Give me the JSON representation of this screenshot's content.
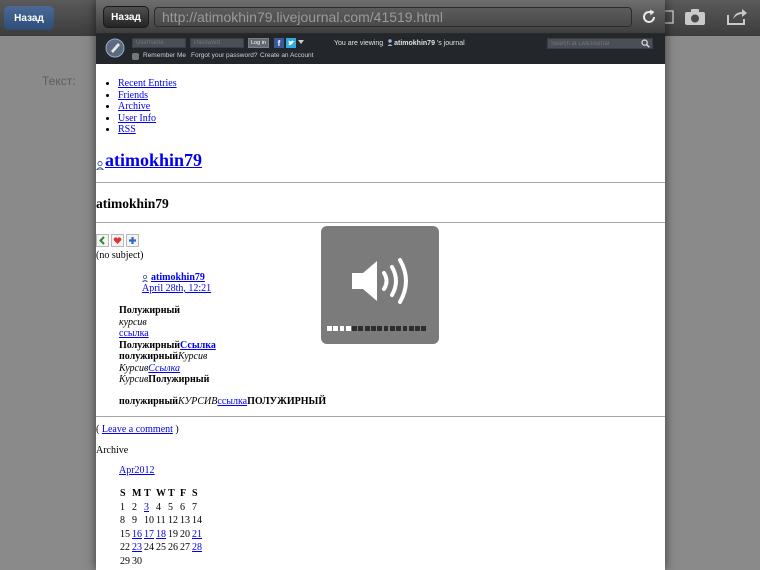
{
  "background_app": {
    "back_label": "Назад",
    "field_label": "Текст:"
  },
  "browser": {
    "back_label": "Назад",
    "url": "http://atimokhin79.livejournal.com/41519.html"
  },
  "lj_bar": {
    "username_placeholder": "Username",
    "password_placeholder": "Password",
    "login_label": "Log in",
    "remember_label": "Remember Me",
    "forgot_label": "Forgot your password?",
    "create_label": "Create an Account",
    "viewing_prefix": "You are viewing",
    "viewing_user": "atimokhin79",
    "viewing_suffix": "'s journal",
    "search_placeholder": "Search at LiveJournal",
    "facebook_letter": "f"
  },
  "nav": {
    "items": [
      "Recent Entries",
      "Friends",
      "Archive",
      "User Info",
      "RSS"
    ]
  },
  "journal": {
    "title_link": "atimokhin79",
    "name_heading": "atimokhin79"
  },
  "entry": {
    "subject": "(no subject)",
    "author": "atimokhin79",
    "date": "April 28th, 12:21",
    "lines": {
      "l1_bold": "Полужирный",
      "l2_italic": "курсив",
      "l3_link": "ссылка",
      "l4_bold": "Полужирный",
      "l4_link": "Ссылка",
      "l5_bold": "полужирный",
      "l5_italic": "Курсив",
      "l6_italic": "Курсив",
      "l6_link": "Ссылка",
      "l7_italic": "Курсив",
      "l7_bold": "Полужирный",
      "final_bold": "полужирный",
      "final_italic": "КУРСИВ",
      "final_link": "ссылка",
      "final_bold2": "ПОЛУЖИРНЫЙ"
    }
  },
  "comments": {
    "open": "( ",
    "link": "Leave a comment",
    "close": " )"
  },
  "archive": {
    "label": "Archive",
    "month_link": "Apr2012",
    "weekdays": [
      "S",
      "M",
      "T",
      "W",
      "T",
      "F",
      "S"
    ],
    "rows": [
      [
        "1",
        "2",
        "3",
        "4",
        "5",
        "6",
        "7"
      ],
      [
        "8",
        "9",
        "10",
        "11",
        "12",
        "13",
        "14"
      ],
      [
        "15",
        "16",
        "17",
        "18",
        "19",
        "20",
        "21"
      ],
      [
        "22",
        "23",
        "24",
        "25",
        "26",
        "27",
        "28"
      ],
      [
        "29",
        "30",
        "",
        "",
        "",
        "",
        ""
      ]
    ],
    "linked_days": [
      "3",
      "16",
      "17",
      "18",
      "21",
      "23",
      "28"
    ]
  },
  "volume": {
    "level": 0.28,
    "segments": 16,
    "icon": "speaker-icon"
  },
  "colors": {
    "link": "#0000ee",
    "lj_bar": "#23272b",
    "hud": "#707070"
  }
}
